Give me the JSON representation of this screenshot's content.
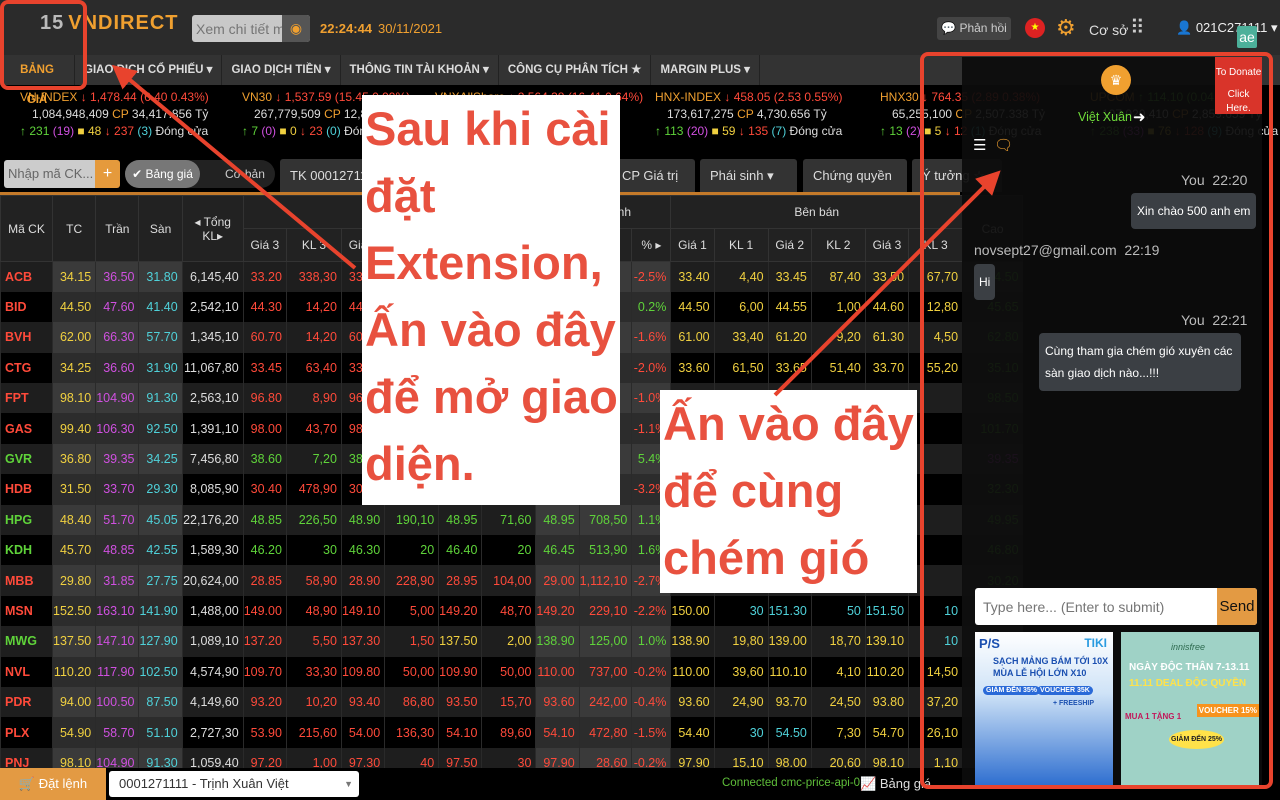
{
  "header": {
    "logo_badge": "15",
    "logo_text": "VNDIRECT",
    "search_placeholder": "Xem chi tiết mã",
    "time": "22:24:44",
    "date": "30/11/2021",
    "feedback_label": "Phản hồi",
    "mode_label": "Cơ sở",
    "user_label": "021C271111",
    "extension_icon": "ae",
    "accent": "#f0a030"
  },
  "nav": [
    {
      "label": "BẢNG GIÁ"
    },
    {
      "label": "GIAO DỊCH CỔ PHIẾU ▾"
    },
    {
      "label": "GIAO DỊCH TIỀN ▾"
    },
    {
      "label": "THÔNG TIN TÀI KHOẢN ▾"
    },
    {
      "label": "CÔNG CỤ PHÂN TÍCH ★"
    },
    {
      "label": "MARGIN PLUS ▾"
    }
  ],
  "indices": [
    {
      "name": "VN-INDEX",
      "value": "↓ 1,478.44 (6.40 0.43%)",
      "volume": "1,084,948,409",
      "value_total": "34,417.856 Tỷ",
      "up": "231",
      "ceil": "(19)",
      "ref": "48",
      "down": "237",
      "floor": "(3)",
      "status": "Đóng cửa"
    },
    {
      "name": "VN30",
      "value": "↓ 1,537.59 (15.45 0.99%)",
      "volume": "267,779,509",
      "value_total": "12,807.8",
      "up": "7",
      "ceil": "(0)",
      "ref": "0",
      "down": "23",
      "floor": "(0)",
      "status": "Đóng cửa"
    },
    {
      "name": "VNXAllShare",
      "value": "↓ 2,564.38 (16.41 0.64%)",
      "volume": "",
      "value_total": "",
      "up": "",
      "ceil": "",
      "ref": "",
      "down": "",
      "floor": "",
      "status": ""
    },
    {
      "name": "HNX-INDEX",
      "value": "↓ 458.05 (2.53 0.55%)",
      "volume": "173,617,275",
      "value_total": "4,730.656 Tỷ",
      "up": "113",
      "ceil": "(20)",
      "ref": "59",
      "down": "135",
      "floor": "(7)",
      "status": "Đóng cửa"
    },
    {
      "name": "HNX30",
      "value": "↓ 764.35 (2.89 0.38%)",
      "volume": "65,255,100",
      "value_total": "2,507.338 Tỷ",
      "up": "13",
      "ceil": "(2)",
      "ref": "5",
      "down": "12",
      "floor": "(1)",
      "status": "Đóng cửa"
    },
    {
      "name": "UPCOM",
      "value": "↑ 114.10 (0.04 0.04%)",
      "volume": "107,920,410",
      "value_total": "2,859.659 Tỷ",
      "up": "238",
      "ceil": "(33)",
      "ref": "76",
      "down": "128",
      "floor": "(9)",
      "status": "Đóng cửa"
    }
  ],
  "toolbar": {
    "symbol_placeholder": "Nhập mã CK...",
    "add_label": "+",
    "toggle_on": "✔ Bảng giá",
    "toggle_off": "Cơ bản",
    "tabs": [
      "TK 0001271111",
      "CP Giá trị ▾",
      "Phái sinh ▾",
      "Chứng quyền ▾",
      "Ý tưởng ☆"
    ]
  },
  "table": {
    "group_headers": {
      "buy": "Bên mua",
      "match": "Khớp lệnh",
      "sell": "Bên bán"
    },
    "columns": [
      "Mã CK",
      "TC",
      "Trần",
      "Sàn",
      "◂ Tổng KL▸",
      "Giá 3",
      "KL 3",
      "Giá 2",
      "KL 2",
      "Giá 1",
      "KL 1",
      "Giá",
      "KL",
      "% ▸",
      "Giá 1",
      "KL 1",
      "Giá 2",
      "KL 2",
      "Giá 3",
      "KL 3",
      "Cao"
    ],
    "rows": [
      [
        "ACB",
        "34.15",
        "36.50",
        "31.80",
        "6,145,40",
        "33.20",
        "338,30",
        "33.20",
        "",
        "",
        "",
        "",
        "",
        "-2.5%",
        "33.40",
        "4,40",
        "33.45",
        "87,40",
        "33.50",
        "67,70",
        "34.50"
      ],
      [
        "BID",
        "44.50",
        "47.60",
        "41.40",
        "2,542,10",
        "44.30",
        "14,20",
        "44.35",
        "",
        "",
        "",
        "",
        "",
        "0.2%",
        "44.50",
        "6,00",
        "44.55",
        "1,00",
        "44.60",
        "12,80",
        "45.65"
      ],
      [
        "BVH",
        "62.00",
        "66.30",
        "57.70",
        "1,345,10",
        "60.70",
        "14,20",
        "60.80",
        "",
        "",
        "",
        "",
        "",
        "-1.6%",
        "61.00",
        "33,40",
        "61.20",
        "9,20",
        "61.30",
        "4,50",
        "62.80"
      ],
      [
        "CTG",
        "34.25",
        "36.60",
        "31.90",
        "11,067,80",
        "33.45",
        "63,40",
        "33.50",
        "",
        "",
        "",
        "",
        "",
        "-2.0%",
        "33.60",
        "61,50",
        "33.65",
        "51,40",
        "33.70",
        "55,20",
        "35.10"
      ],
      [
        "FPT",
        "98.10",
        "104.90",
        "91.30",
        "2,563,10",
        "96.80",
        "8,90",
        "96.90",
        "",
        "",
        "",
        "",
        "",
        "-1.0%",
        "",
        "",
        "",
        "",
        "",
        "",
        "98.50"
      ],
      [
        "GAS",
        "99.40",
        "106.30",
        "92.50",
        "1,391,10",
        "98.00",
        "43,70",
        "98.10",
        "",
        "",
        "",
        "",
        "",
        "-1.1%",
        "",
        "",
        "",
        "",
        "",
        "",
        "101.70"
      ],
      [
        "GVR",
        "36.80",
        "39.35",
        "34.25",
        "7,456,80",
        "38.60",
        "7,20",
        "38.65",
        "",
        "",
        "",
        "",
        "",
        "5.4%",
        "",
        "",
        "",
        "",
        "",
        "",
        "39.35"
      ],
      [
        "HDB",
        "31.50",
        "33.70",
        "29.30",
        "8,085,90",
        "30.40",
        "478,90",
        "30.45",
        "",
        "",
        "",
        "",
        "",
        "-3.2%",
        "",
        "",
        "",
        "",
        "",
        "",
        "32.30"
      ],
      [
        "HPG",
        "48.40",
        "51.70",
        "45.05",
        "22,176,20",
        "48.85",
        "226,50",
        "48.90",
        "190,10",
        "48.95",
        "71,60",
        "48.95",
        "708,50",
        "1.1%",
        "",
        "",
        "",
        "",
        "",
        "",
        "49.95"
      ],
      [
        "KDH",
        "45.70",
        "48.85",
        "42.55",
        "1,589,30",
        "46.20",
        "30",
        "46.30",
        "20",
        "46.40",
        "20",
        "46.45",
        "513,90",
        "1.6%",
        "",
        "",
        "",
        "",
        "",
        "",
        "46.80"
      ],
      [
        "MBB",
        "29.80",
        "31.85",
        "27.75",
        "20,624,00",
        "28.85",
        "58,90",
        "28.90",
        "228,90",
        "28.95",
        "104,00",
        "29.00",
        "1,112,10",
        "-2.7%",
        "",
        "",
        "",
        "",
        "",
        "",
        "30.20"
      ],
      [
        "MSN",
        "152.50",
        "163.10",
        "141.90",
        "1,488,00",
        "149.00",
        "48,90",
        "149.10",
        "5,00",
        "149.20",
        "48,70",
        "149.20",
        "229,10",
        "-2.2%",
        "150.00",
        "30",
        "151.30",
        "50",
        "151.50",
        "10",
        "153.90"
      ],
      [
        "MWG",
        "137.50",
        "147.10",
        "127.90",
        "1,089,10",
        "137.20",
        "5,50",
        "137.30",
        "1,50",
        "137.50",
        "2,00",
        "138.90",
        "125,00",
        "1.0%",
        "138.90",
        "19,80",
        "139.00",
        "18,70",
        "139.10",
        "10",
        "139.90"
      ],
      [
        "NVL",
        "110.20",
        "117.90",
        "102.50",
        "4,574,90",
        "109.70",
        "33,30",
        "109.80",
        "50,00",
        "109.90",
        "50,00",
        "110.00",
        "737,00",
        "-0.2%",
        "110.00",
        "39,60",
        "110.10",
        "4,10",
        "110.20",
        "14,50",
        "111.90"
      ],
      [
        "PDR",
        "94.00",
        "100.50",
        "87.50",
        "4,149,60",
        "93.20",
        "10,20",
        "93.40",
        "86,80",
        "93.50",
        "15,70",
        "93.60",
        "242,00",
        "-0.4%",
        "93.60",
        "24,90",
        "93.70",
        "24,50",
        "93.80",
        "37,20",
        "94.90"
      ],
      [
        "PLX",
        "54.90",
        "58.70",
        "51.10",
        "2,727,30",
        "53.90",
        "215,60",
        "54.00",
        "136,30",
        "54.10",
        "89,60",
        "54.10",
        "472,80",
        "-1.5%",
        "54.40",
        "30",
        "54.50",
        "7,30",
        "54.70",
        "26,10",
        "56.70"
      ],
      [
        "PNJ",
        "98.10",
        "104.90",
        "91.30",
        "1,059,40",
        "97.20",
        "1,00",
        "97.30",
        "40",
        "97.50",
        "30",
        "97.90",
        "28,60",
        "-0.2%",
        "97.90",
        "15,10",
        "98.00",
        "20,60",
        "98.10",
        "1,10",
        "100.30"
      ]
    ]
  },
  "footer": {
    "order_label": "🛒 Đặt lệnh",
    "account": "0001271111 - Trịnh Xuân Việt",
    "connection": "Connected cmc-price-api-01",
    "board_label": "Bảng giá"
  },
  "chat": {
    "donate_line1": "To Donate",
    "donate_line2": "Click Here.",
    "user_name": "Việt Xuân",
    "messages": [
      {
        "author": "You",
        "time": "22:20",
        "text": "Xin chào 500 anh em"
      },
      {
        "author": "novsept27@gmail.com",
        "time": "22:19",
        "text": "Hi"
      },
      {
        "author": "You",
        "time": "22:21",
        "text": "Cùng tham gia chém gió xuyên các sàn giao dịch nào...!!!"
      }
    ],
    "input_placeholder": "Type here... (Enter to submit)",
    "send_label": "Send",
    "ad1": {
      "brand": "P/S",
      "store": "TIKI",
      "line1": "SẠCH MẢNG BÁM TỚI 10X",
      "line2": "MÙA LỄ HỘI LỚN X10",
      "badge1": "GIẢM ĐẾN 35%",
      "badge2": "VOUCHER 35K",
      "badge3": "+ FREESHIP"
    },
    "ad2": {
      "brand": "innisfree",
      "line1": "NGÀY ĐỘC THÂN 7-13.11",
      "line2": "11.11 DEAL ĐỘC QUYỀN",
      "badge1": "MUA 1 TẶNG 1",
      "badge2": "GIẢM ĐẾN 25%",
      "badge3": "VOUCHER 15%"
    }
  },
  "annotations": {
    "note1": [
      "Sau khi cài",
      "đặt",
      "Extension,",
      "Ấn vào đây",
      "để mở giao",
      "diện."
    ],
    "note2": [
      "Ấn vào đây",
      "để cùng",
      "chém gió"
    ],
    "color": "#e8432d"
  },
  "colors": {
    "up": "#5fd33a",
    "down": "#ff4a3a",
    "ref": "#f0d040",
    "ceiling": "#d050e0",
    "floor": "#4fd1d9"
  }
}
